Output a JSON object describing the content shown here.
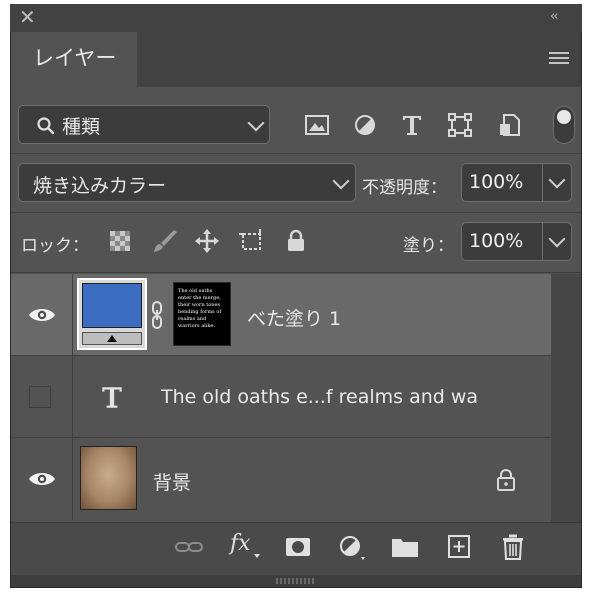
{
  "panel": {
    "tab_label": "レイヤー",
    "filter": {
      "search_icon": "search-icon",
      "label": "種類"
    },
    "filter_icons": [
      "image-filter-icon",
      "adjustment-filter-icon",
      "type-filter-icon",
      "shape-filter-icon",
      "smart-object-filter-icon"
    ],
    "blend_mode": "焼き込みカラー",
    "opacity_label": "不透明度：",
    "opacity_value": "100%",
    "lock_label": "ロック：",
    "fill_label": "塗り：",
    "fill_value": "100%"
  },
  "layers": [
    {
      "name": "べた塗り 1",
      "visible": true,
      "selected": true,
      "thumb_text": "The old oaths enter the merge, their worn tones bending forms of realms and warriors alike."
    },
    {
      "name": "The old oaths e...f realms and wa",
      "visible": false,
      "selected": false,
      "type_glyph": "T"
    },
    {
      "name": "背景",
      "visible": true,
      "selected": false,
      "locked": true
    }
  ],
  "footer": {
    "fx_label": "fx"
  },
  "colors": {
    "panel": "#535353",
    "selected_row": "#696969",
    "layer_fill": "#3a6cc0"
  }
}
